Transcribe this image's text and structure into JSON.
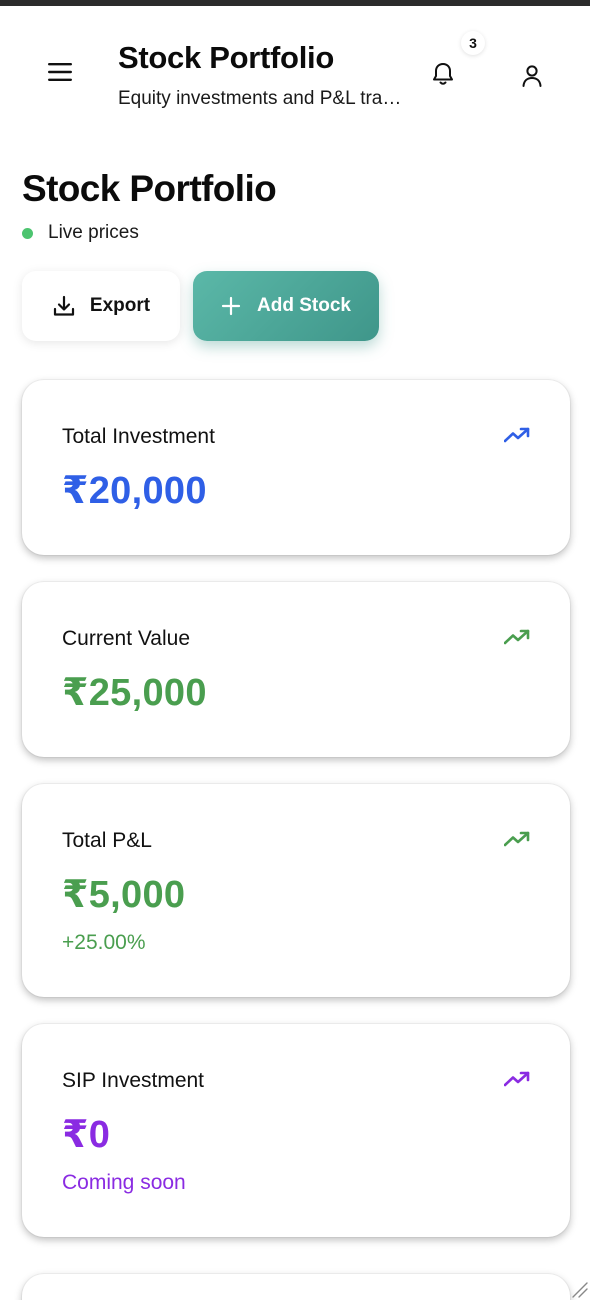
{
  "header": {
    "title": "Stock Portfolio",
    "subtitle": "Equity investments and P&L tracking",
    "notification_count": "3",
    "icons": {
      "menu": "hamburger-menu-icon",
      "bell": "bell-icon",
      "user": "user-icon"
    }
  },
  "page": {
    "title": "Stock Portfolio",
    "live_status": "Live prices",
    "live_color": "#4cc46f"
  },
  "actions": {
    "export_label": "Export",
    "add_label": "Add Stock",
    "accent": "#4fa99b"
  },
  "cards": [
    {
      "label": "Total Investment",
      "value": "₹20,000",
      "sub": "",
      "color": "#2f5fe6",
      "icon": "trending-up-icon"
    },
    {
      "label": "Current Value",
      "value": "₹25,000",
      "sub": "",
      "color": "#4a9e4f",
      "icon": "trending-up-icon"
    },
    {
      "label": "Total P&L",
      "value": "₹5,000",
      "sub": "+25.00%",
      "color": "#4a9e4f",
      "icon": "trending-up-icon"
    },
    {
      "label": "SIP Investment",
      "value": "₹0",
      "sub": "Coming soon",
      "color": "#8a2be2",
      "icon": "trending-up-icon"
    }
  ]
}
